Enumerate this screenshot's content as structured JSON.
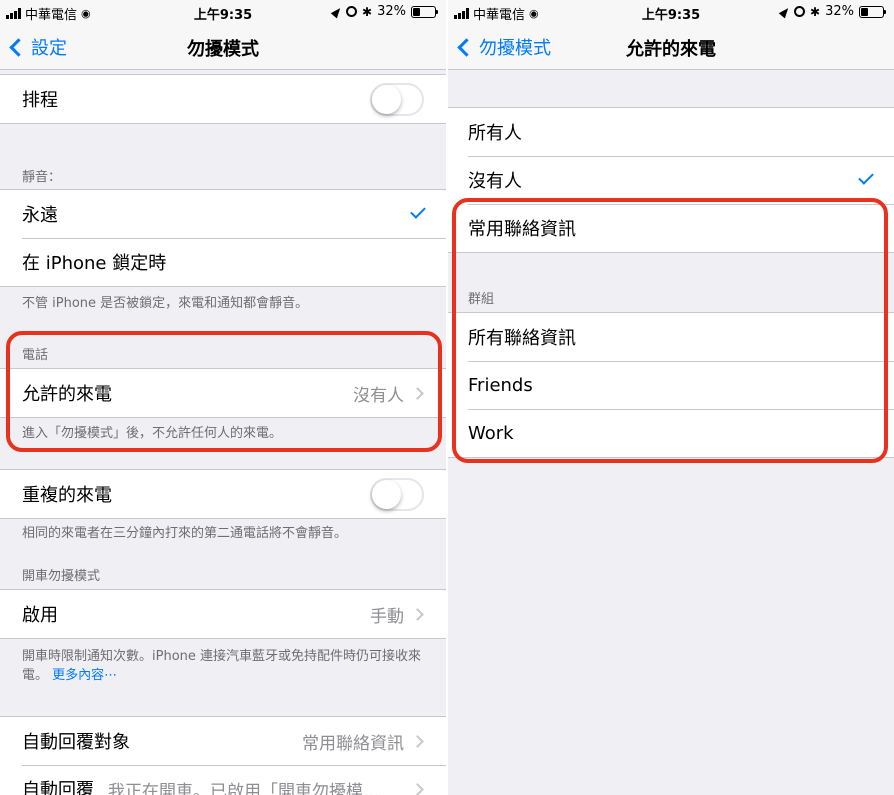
{
  "status_bar": {
    "carrier": "中華電信",
    "time": "上午9:35",
    "battery": "32%",
    "battery_level": 0.32
  },
  "left_screen": {
    "back_label": "設定",
    "title": "勿擾模式",
    "schedule_label": "排程",
    "schedule_on": false,
    "silence_header": "靜音：",
    "silence_always": "永遠",
    "silence_locked": "在 iPhone 鎖定時",
    "silence_selected": "always",
    "silence_footer": "不管 iPhone 是否被鎖定，來電和通知都會靜音。",
    "phone_header": "電話",
    "allow_calls_label": "允許的來電",
    "allow_calls_value": "沒有人",
    "phone_footer": "進入「勿擾模式」後，不允許任何人的來電。",
    "repeated_calls_label": "重複的來電",
    "repeated_calls_on": false,
    "repeated_footer": "相同的來電者在三分鐘內打來的第二通電話將不會靜音。",
    "driving_header": "開車勿擾模式",
    "activate_label": "啟用",
    "activate_value": "手動",
    "driving_footer": "開車時限制通知次數。iPhone 連接汽車藍牙或免持配件時仍可接收來電。",
    "driving_footer_link": "更多內容⋯",
    "auto_reply_to_label": "自動回覆對象",
    "auto_reply_to_value": "常用聯絡資訊",
    "auto_reply_label": "自動回覆",
    "auto_reply_value": "我正在開車。已啟用「開車勿擾模..."
  },
  "right_screen": {
    "back_label": "勿擾模式",
    "title": "允許的來電",
    "options": [
      "所有人",
      "沒有人",
      "常用聯絡資訊"
    ],
    "selected_option": "沒有人",
    "groups_header": "群組",
    "groups": [
      "所有聯絡資訊",
      "Friends",
      "Work"
    ]
  },
  "colors": {
    "accent": "#007aff",
    "highlight": "#e8321e",
    "background": "#efeff4"
  }
}
